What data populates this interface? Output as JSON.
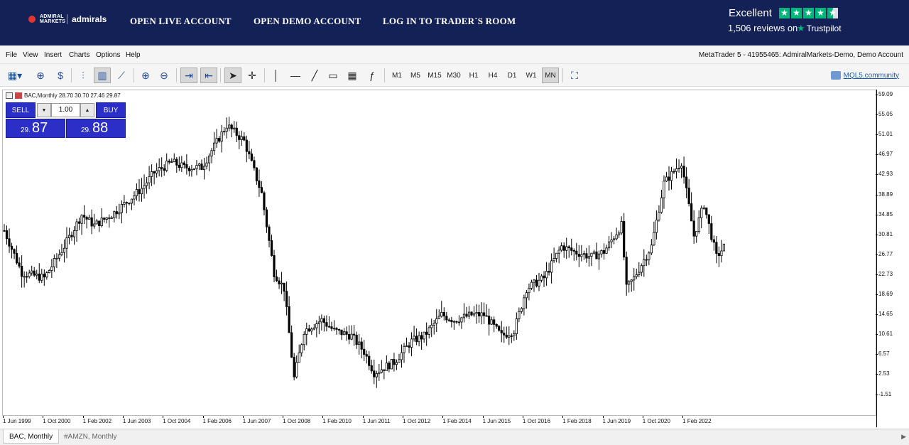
{
  "header": {
    "logo_small": "ADMIRAL MARKETS",
    "logo_text": "admirals",
    "nav": [
      "OPEN LIVE ACCOUNT",
      "OPEN DEMO ACCOUNT",
      "LOG IN TO TRADER`S ROOM"
    ],
    "trustpilot": {
      "rating_text": "Excellent",
      "reviews": "1,506 reviews on",
      "brand": "Trustpilot",
      "stars": 4.5
    }
  },
  "menu": {
    "items": [
      "File",
      "View",
      "Insert",
      "Charts",
      "Options",
      "Help"
    ],
    "account": "MetaTrader 5 - 41955465: AdmiralMarkets-Demo, Demo Account"
  },
  "toolbar": {
    "timeframes": [
      "M1",
      "M5",
      "M15",
      "M30",
      "H1",
      "H4",
      "D1",
      "W1",
      "MN"
    ],
    "selected_timeframe": "MN",
    "community": "MQL5.community"
  },
  "chart": {
    "symbol_line": "BAC,Monthly  28.70 30.70 27.46 29.87",
    "one_click": {
      "sell": "SELL",
      "buy": "BUY",
      "volume": "1.00",
      "bid_prefix": "29.",
      "bid_big": "87",
      "ask_prefix": "29.",
      "ask_big": "88"
    },
    "price_labels": [
      "59.09",
      "55.05",
      "51.01",
      "46.97",
      "42.93",
      "38.89",
      "34.85",
      "30.81",
      "26.77",
      "22.73",
      "18.69",
      "14.65",
      "10.61",
      "6.57",
      "2.53",
      "-1.51"
    ],
    "time_labels": [
      "1 Jun 1999",
      "1 Oct 2000",
      "1 Feb 2002",
      "1 Jun 2003",
      "1 Oct 2004",
      "1 Feb 2006",
      "1 Jun 2007",
      "1 Oct 2008",
      "1 Feb 2010",
      "1 Jun 2011",
      "1 Oct 2012",
      "1 Feb 2014",
      "1 Jun 2015",
      "1 Oct 2016",
      "1 Feb 2018",
      "1 Jun 2019",
      "1 Oct 2020",
      "1 Feb 2022"
    ]
  },
  "chart_data": {
    "type": "line",
    "title": "",
    "ylim": [
      -1.51,
      59.09
    ],
    "series": [
      {
        "x": [
          "1999-06",
          "2000-01",
          "2000-10",
          "2001-06",
          "2002-01",
          "2002-06",
          "2003-01",
          "2003-06",
          "2004-01",
          "2004-06",
          "2005-01",
          "2005-06",
          "2006-01",
          "2006-06",
          "2006-11",
          "2007-06",
          "2008-01",
          "2008-06",
          "2008-10",
          "2009-02",
          "2009-06",
          "2010-01",
          "2010-06",
          "2011-01",
          "2011-06",
          "2011-10",
          "2012-06",
          "2013-01",
          "2013-06",
          "2014-01",
          "2014-06",
          "2015-01",
          "2015-06",
          "2016-01",
          "2016-06",
          "2016-11",
          "2017-06",
          "2018-01",
          "2018-06",
          "2019-01",
          "2019-06",
          "2020-01",
          "2020-03",
          "2020-06",
          "2021-01",
          "2021-06",
          "2022-01",
          "2022-06",
          "2022-10",
          "2023-03",
          "2023-06"
        ],
        "values": [
          33.0,
          25.0,
          24.0,
          30.0,
          36.0,
          34.0,
          36.0,
          38.0,
          41.0,
          44.0,
          46.0,
          45.0,
          45.0,
          49.0,
          53.0,
          50.0,
          40.0,
          25.0,
          22.0,
          5.0,
          14.0,
          16.0,
          14.0,
          13.0,
          10.0,
          6.0,
          8.0,
          12.0,
          13.0,
          17.0,
          16.0,
          17.0,
          17.0,
          13.0,
          14.0,
          22.0,
          24.0,
          30.0,
          29.0,
          28.0,
          29.0,
          34.0,
          22.0,
          24.0,
          30.0,
          42.0,
          46.0,
          32.0,
          38.0,
          28.0,
          29.87
        ]
      }
    ]
  }
}
